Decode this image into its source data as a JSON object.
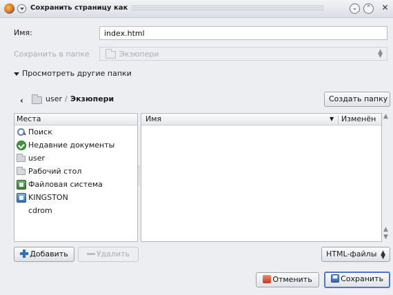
{
  "window": {
    "title": "Сохранить страницу как",
    "menu_icon": "chevron-down-icon",
    "btn_minimize": "⌄",
    "btn_maximize": "⌃",
    "btn_close": "✕"
  },
  "form": {
    "name_label": "Имя:",
    "name_value": "index.html",
    "folder_label": "Сохранить в папке",
    "folder_value": "Экзюпери"
  },
  "expander": {
    "label": "Просмотреть другие папки"
  },
  "pathbar": {
    "back": "‹",
    "crumbs": [
      "user",
      "Экзюпери"
    ],
    "create_folder": "Создать папку"
  },
  "places": {
    "header": "Места",
    "items": [
      {
        "label": "Поиск",
        "icon": "search-icon"
      },
      {
        "label": "Недавние документы",
        "icon": "recent-icon"
      },
      {
        "label": "user",
        "icon": "folder-icon"
      },
      {
        "label": "Рабочий стол",
        "icon": "folder-icon"
      },
      {
        "label": "Файловая система",
        "icon": "filesystem-icon"
      },
      {
        "label": "KINGSTON",
        "icon": "usb-drive-icon"
      },
      {
        "label": "cdrom",
        "icon": "cdrom-icon"
      }
    ],
    "add_button": "Добавить",
    "remove_button": "Удалить"
  },
  "files": {
    "col_name": "Имя",
    "sort_indicator": "▼",
    "col_modified": "Изменён"
  },
  "filter": {
    "value": "HTML-файлы"
  },
  "actions": {
    "cancel": "Отменить",
    "save": "Сохранить"
  },
  "colors": {
    "accent": "#4a77c6",
    "background": "#eceef1"
  }
}
